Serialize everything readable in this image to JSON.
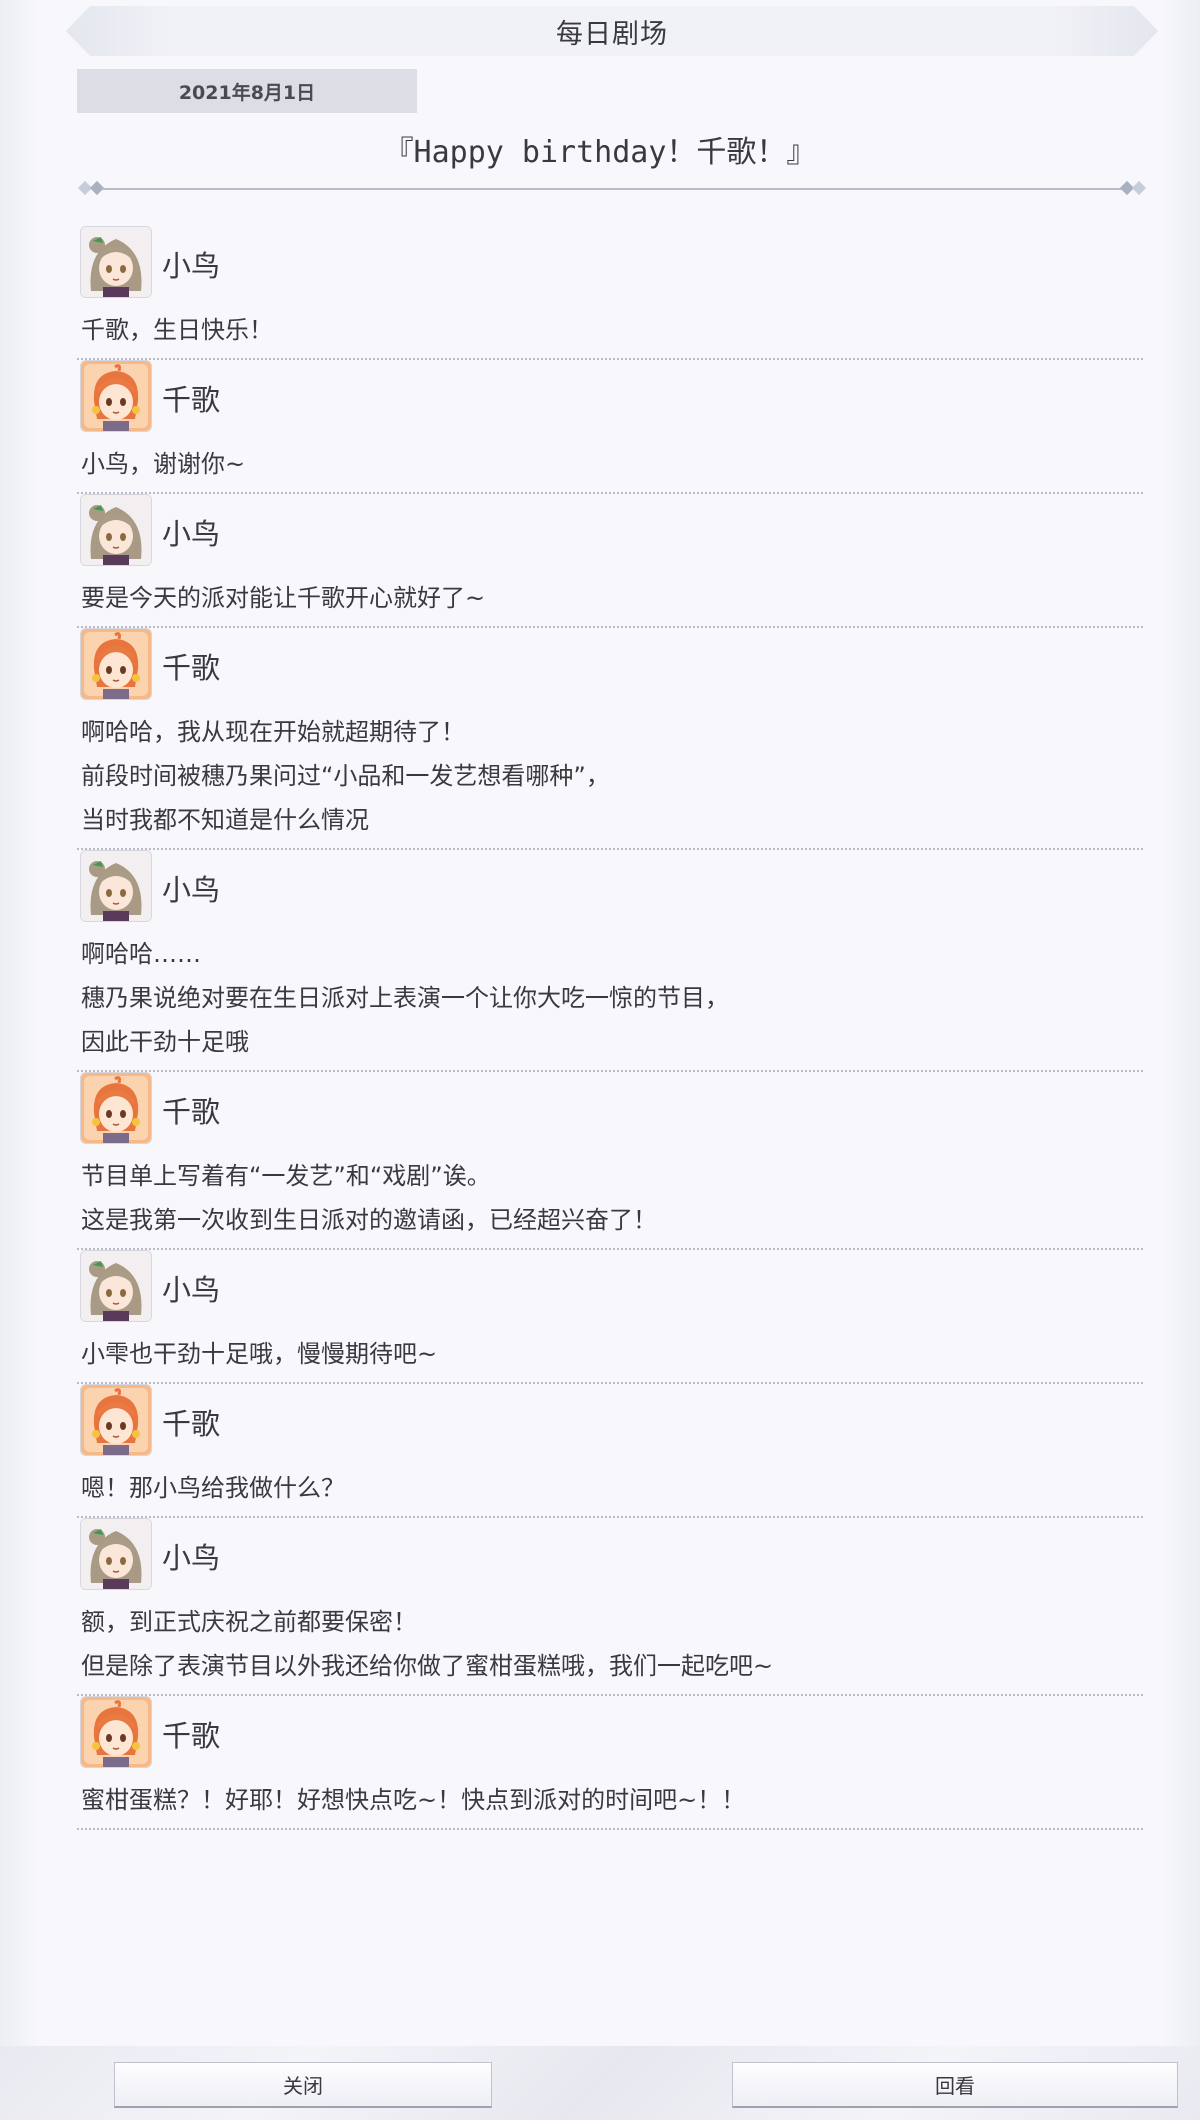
{
  "header": {
    "title": "每日剧场"
  },
  "episode": {
    "date": "2021年8月1日",
    "title": "『Happy birthday！千歌！』"
  },
  "dialogue": [
    {
      "speaker": "小鸟",
      "avatar_icon": "kotori-avatar-icon",
      "lines": [
        "千歌，生日快乐！"
      ]
    },
    {
      "speaker": "千歌",
      "avatar_icon": "chika-avatar-icon",
      "lines": [
        "小鸟，谢谢你~"
      ]
    },
    {
      "speaker": "小鸟",
      "avatar_icon": "kotori-avatar-icon",
      "lines": [
        "要是今天的派对能让千歌开心就好了~"
      ]
    },
    {
      "speaker": "千歌",
      "avatar_icon": "chika-avatar-icon",
      "lines": [
        "啊哈哈，我从现在开始就超期待了！",
        "前段时间被穗乃果问过“小品和一发艺想看哪种”，",
        "当时我都不知道是什么情况"
      ]
    },
    {
      "speaker": "小鸟",
      "avatar_icon": "kotori-avatar-icon",
      "lines": [
        "啊哈哈……",
        "穗乃果说绝对要在生日派对上表演一个让你大吃一惊的节目，",
        "因此干劲十足哦"
      ]
    },
    {
      "speaker": "千歌",
      "avatar_icon": "chika-avatar-icon",
      "lines": [
        "节目单上写着有“一发艺”和“戏剧”诶。",
        "这是我第一次收到生日派对的邀请函，已经超兴奋了！"
      ]
    },
    {
      "speaker": "小鸟",
      "avatar_icon": "kotori-avatar-icon",
      "lines": [
        "小雫也干劲十足哦，慢慢期待吧~"
      ]
    },
    {
      "speaker": "千歌",
      "avatar_icon": "chika-avatar-icon",
      "lines": [
        "嗯！那小鸟给我做什么？"
      ]
    },
    {
      "speaker": "小鸟",
      "avatar_icon": "kotori-avatar-icon",
      "lines": [
        "额，到正式庆祝之前都要保密！",
        "但是除了表演节目以外我还给你做了蜜柑蛋糕哦，我们一起吃吧~"
      ]
    },
    {
      "speaker": "千歌",
      "avatar_icon": "chika-avatar-icon",
      "lines": [
        "蜜柑蛋糕？！好耶！好想快点吃~！快点到派对的时间吧~！！"
      ]
    }
  ],
  "footer": {
    "close_label": "关闭",
    "replay_label": "回看"
  }
}
